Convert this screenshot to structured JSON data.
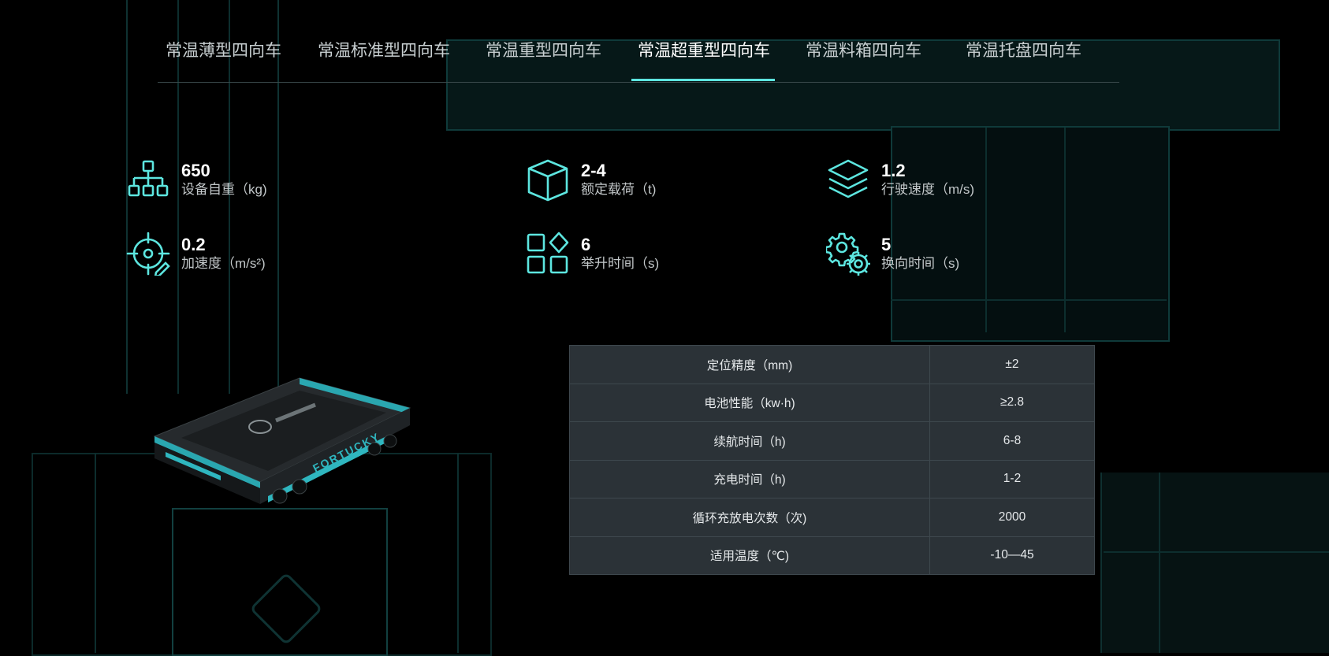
{
  "tabs": [
    {
      "label": "常温薄型四向车",
      "active": false
    },
    {
      "label": "常温标准型四向车",
      "active": false
    },
    {
      "label": "常温重型四向车",
      "active": false
    },
    {
      "label": "常温超重型四向车",
      "active": true
    },
    {
      "label": "常温料箱四向车",
      "active": false
    },
    {
      "label": "常温托盘四向车",
      "active": false
    }
  ],
  "accent_color": "#5de6e0",
  "stats": [
    {
      "value": "650",
      "label": "设备自重（kg)",
      "icon": "org-chart-icon"
    },
    {
      "value": "2-4",
      "label": "额定载荷（t)",
      "icon": "cube-icon"
    },
    {
      "value": "1.2",
      "label": "行驶速度（m/s)",
      "icon": "layers-icon"
    },
    {
      "value": "0.2",
      "label": "加速度（m/s²)",
      "icon": "crosshair-pen-icon"
    },
    {
      "value": "6",
      "label": "举升时间（s)",
      "icon": "grid-shapes-icon"
    },
    {
      "value": "5",
      "label": "换向时间（s)",
      "icon": "gears-icon"
    }
  ],
  "specs": [
    {
      "name": "定位精度（mm)",
      "value": "±2"
    },
    {
      "name": "电池性能（kw·h)",
      "value": "≥2.8"
    },
    {
      "name": "续航时间（h)",
      "value": "6-8"
    },
    {
      "name": "充电时间（h)",
      "value": "1-2"
    },
    {
      "name": "循环充放电次数（次)",
      "value": "2000"
    },
    {
      "name": "适用温度（℃)",
      "value": "-10—45"
    }
  ],
  "vehicle": {
    "side_text": "FORTUCKY"
  }
}
